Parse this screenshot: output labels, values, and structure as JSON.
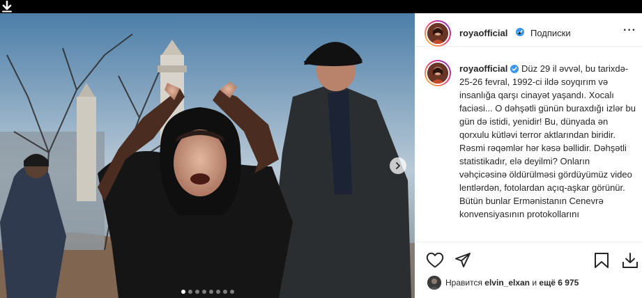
{
  "post": {
    "username": "royaofficial",
    "separator": "•",
    "follow_label": "Подписки",
    "more_label": "···",
    "caption": "Düz 29 il əvvəl, bu tarixdə- 25-26 fevral, 1992-ci ildə soyqırım və insanlığa qarşı cinayət yaşandı. Xocalı faciəsi... O dəhşətli günün buraxdığı izlər bu gün də istidi, yenidir! Bu, dünyada ən qorxulu kütləvi terror aktlarından biridir. Rəsmi rəqəmlər hər kəsə bəllidir. Dəhşətli statistikadır, elə deyilmi? Onların vəhçicəsinə öldürülməsi gördüyümüz video lentlərdən, fotolardan açıq-aşkar görünür. Bütün bunlar Ermənistanın Cenevrə konvensiyasının protokollarını",
    "likes": {
      "prefix": "Нравится",
      "user": "elvin_elxan",
      "middle": "и",
      "count": "ещё 6 975"
    }
  },
  "carousel": {
    "slide_count": 8,
    "active_index": 0
  },
  "icons": [
    "download-arrow-icon",
    "verified-badge-icon",
    "chevron-right-icon",
    "heart-icon",
    "share-icon",
    "bookmark-icon",
    "download-icon"
  ],
  "colors": {
    "verified": "#3897f0",
    "text": "#262626",
    "border": "#efefef"
  }
}
